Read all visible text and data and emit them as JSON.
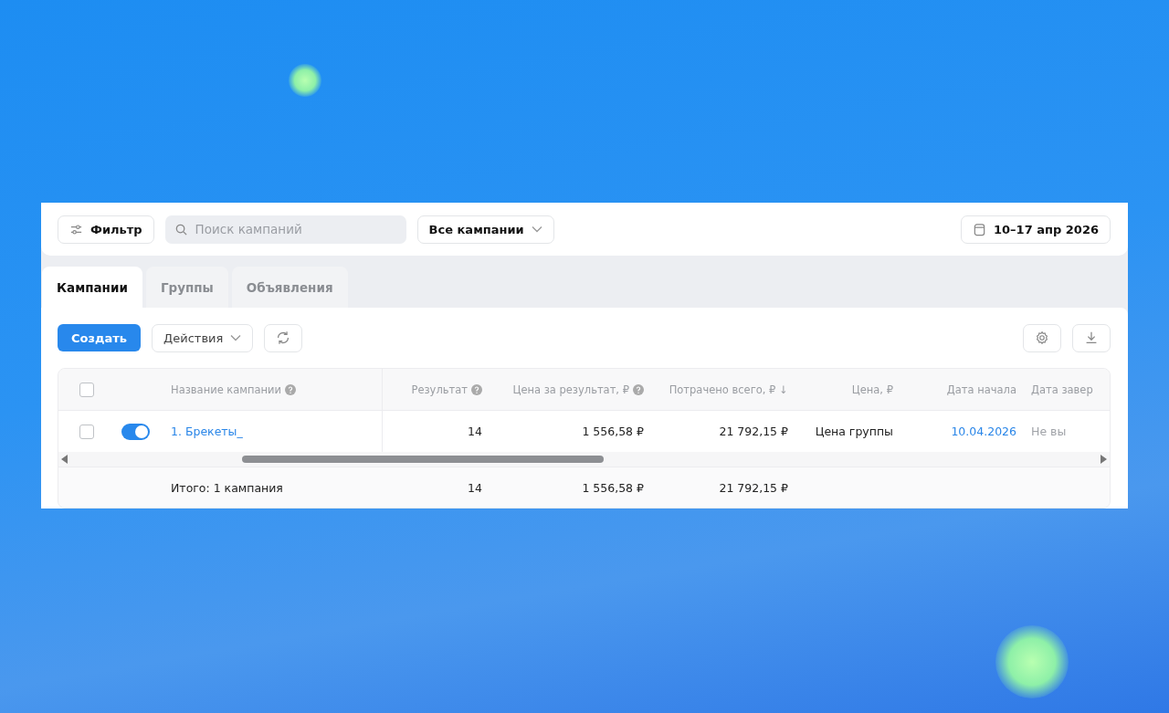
{
  "toolbar": {
    "filter_button": "Фильтр",
    "search": {
      "placeholder": "Поиск кампаний"
    },
    "scope_dropdown": "Все кампании",
    "date_range": "10–17 апр 2026"
  },
  "tabs": [
    {
      "label": "Кампании",
      "selected": true
    },
    {
      "label": "Группы",
      "selected": false
    },
    {
      "label": "Объявления",
      "selected": false
    }
  ],
  "actions": {
    "create_button": "Создать",
    "actions_dropdown": "Действия"
  },
  "table": {
    "header_checked": false,
    "columns": [
      {
        "label": "Название кампании",
        "help": true
      },
      {
        "label": "Результат",
        "help": true
      },
      {
        "label": "Цена за результат, ₽",
        "help": true
      },
      {
        "label": "Потрачено всего, ₽",
        "sort_mark": "↓",
        "help": false
      },
      {
        "label": "Цена, ₽",
        "help": false
      },
      {
        "label": "Дата начала",
        "help": false
      },
      {
        "label": "Дата завер",
        "help": false
      }
    ],
    "rows": [
      {
        "checked": false,
        "on": true,
        "cells": [
          {
            "text": "1. Брекеты_",
            "kind": "link"
          },
          {
            "text": "14",
            "kind": "plain"
          },
          {
            "text": "1 556,58 ₽",
            "kind": "plain"
          },
          {
            "text": "21 792,15 ₽",
            "kind": "plain"
          },
          {
            "text": "Цена группы",
            "kind": "plain"
          },
          {
            "text": "10.04.2026",
            "kind": "link"
          },
          {
            "text": "Не вы",
            "kind": "muted"
          }
        ]
      }
    ],
    "footer": [
      "Итого: 1 кампания",
      "14",
      "1 556,58 ₽",
      "21 792,15 ₽"
    ]
  }
}
